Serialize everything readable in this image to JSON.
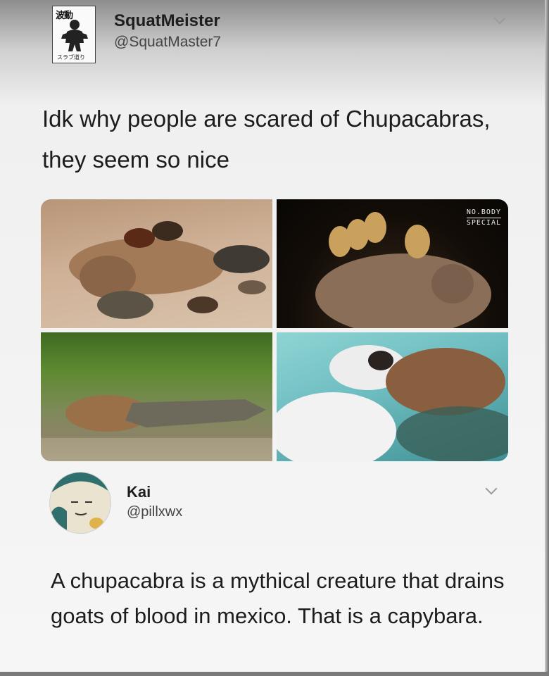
{
  "tweet1": {
    "author_name": "SquatMeister",
    "author_handle": "@SquatMaster7",
    "avatar_kanji": "波動",
    "avatar_caption": "スラブ道り",
    "text": "Idk why people are scared of Chupacabras, they seem so nice",
    "icons": {
      "avatar": "avatar-figure-icon",
      "menu": "chevron-down-icon"
    }
  },
  "photos": [
    {
      "subject": "capybara-with-ducks-and-turtles"
    },
    {
      "subject": "capybara-with-monkeys",
      "watermark_line1": "NO.BODY",
      "watermark_line2": "SPECIAL"
    },
    {
      "subject": "capybara-beside-caiman"
    },
    {
      "subject": "capybara-with-rabbit"
    }
  ],
  "tweet2": {
    "author_name": "Kai",
    "author_handle": "@pillxwx",
    "text": "A chupacabra is a mythical creature that drains goats of blood in mexico. That is a capybara.",
    "icons": {
      "avatar": "snorlax-avatar-icon",
      "menu": "chevron-down-icon"
    }
  },
  "colors": {
    "text": "#1c1c1c",
    "handle": "#444444",
    "background": "#f6f6f6"
  }
}
